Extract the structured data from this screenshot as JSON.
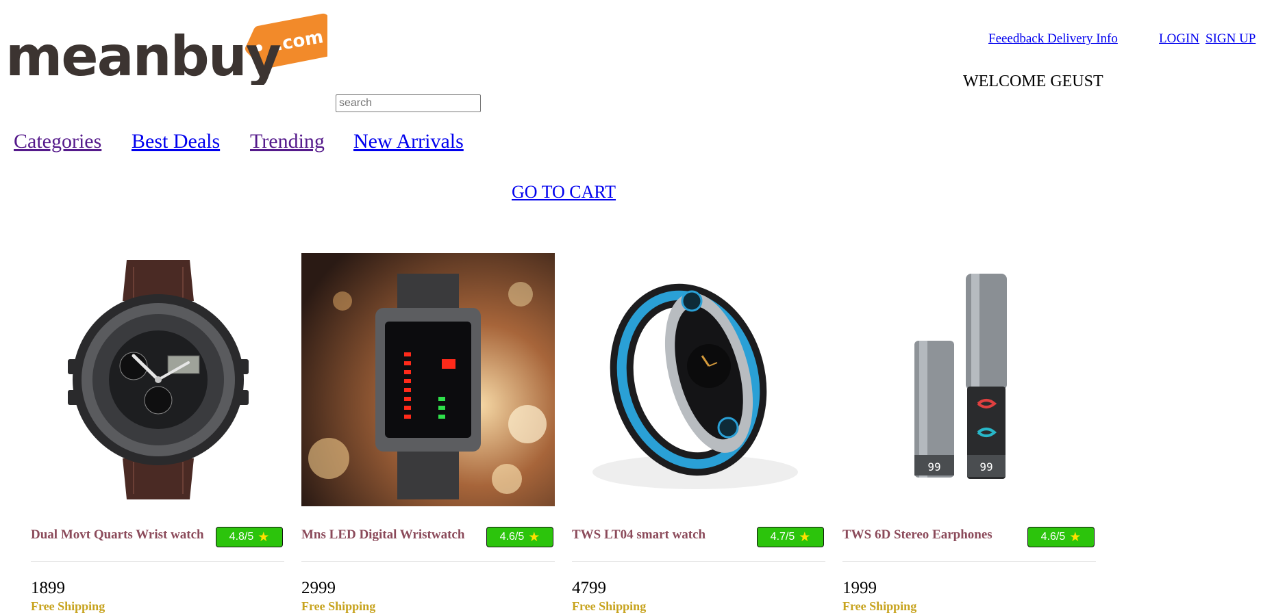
{
  "header": {
    "logo": {
      "wordmark": "meanbuy",
      "tag": ".com"
    },
    "search": {
      "placeholder": "search",
      "value": ""
    },
    "links": {
      "feedback": "Feeedback Delivery Info",
      "login": "LOGIN",
      "signup": "SIGN UP"
    },
    "welcome": "WELCOME GEUST"
  },
  "nav": {
    "items": [
      {
        "label": "Categories"
      },
      {
        "label": "Best Deals"
      },
      {
        "label": "Trending"
      },
      {
        "label": "New Arrivals"
      }
    ],
    "cart": "GO TO CART"
  },
  "products": [
    {
      "name": "Dual Movt Quarts Wrist watch",
      "rating": "4.8/5",
      "price": "1899",
      "shipping": "Free Shipping"
    },
    {
      "name": "Mns LED Digital Wristwatch",
      "rating": "4.6/5",
      "price": "2999",
      "shipping": "Free Shipping"
    },
    {
      "name": "TWS LT04 smart watch",
      "rating": "4.7/5",
      "price": "4799",
      "shipping": "Free Shipping"
    },
    {
      "name": "TWS 6D Stereo Earphones",
      "rating": "4.6/5",
      "price": "1999",
      "shipping": "Free Shipping"
    }
  ],
  "colors": {
    "link": "#0000ee",
    "visited_link": "#551a8b",
    "product_name": "#8b4a5a",
    "rating_badge": "#2cc40c",
    "star": "#ffe000",
    "shipping": "#c7a31e",
    "logo_orange": "#f28a2a",
    "logo_text": "#3c3431"
  },
  "icons": {
    "rating_star": "star-icon"
  }
}
